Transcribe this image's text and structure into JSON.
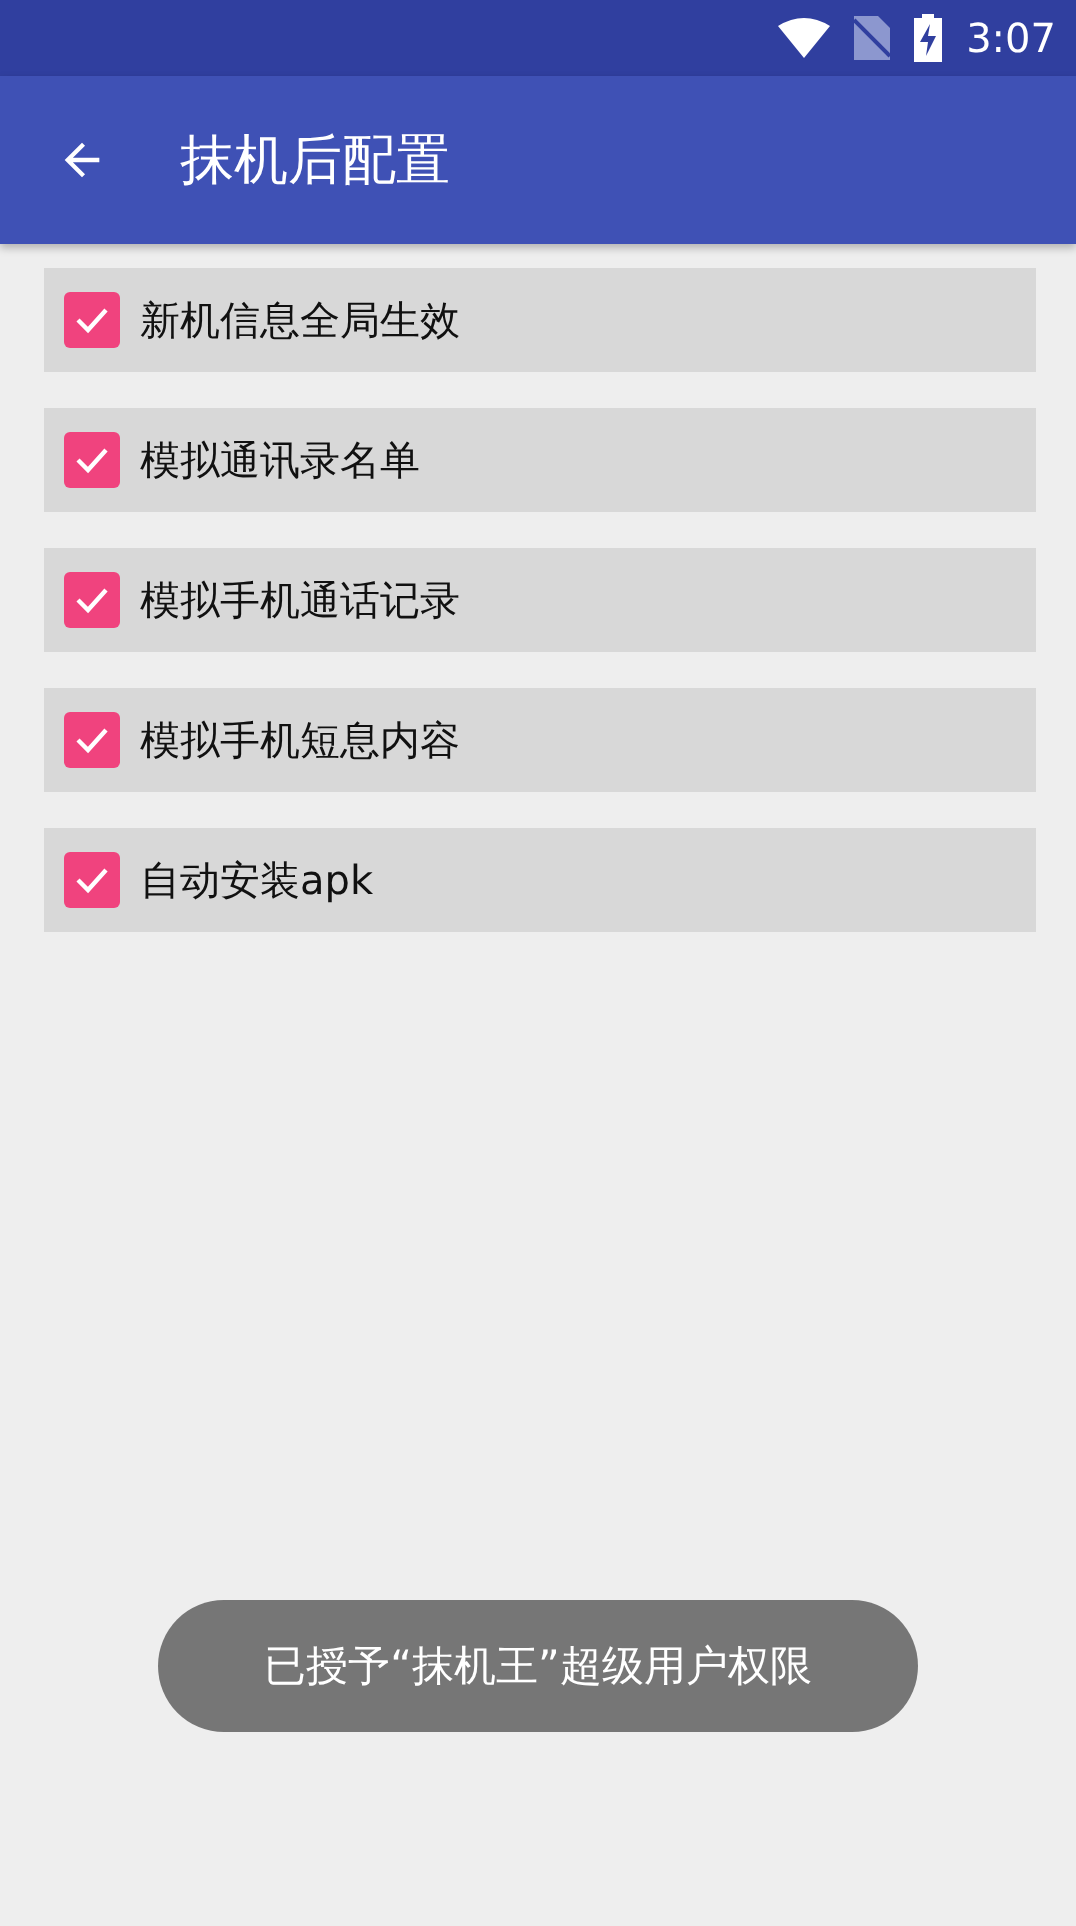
{
  "status_bar": {
    "time": "3:07"
  },
  "app_bar": {
    "title": "抹机后配置"
  },
  "options": [
    {
      "label": "新机信息全局生效",
      "checked": true
    },
    {
      "label": "模拟通讯录名单",
      "checked": true
    },
    {
      "label": "模拟手机通话记录",
      "checked": true
    },
    {
      "label": "模拟手机短息内容",
      "checked": true
    },
    {
      "label": "自动安装apk",
      "checked": true
    }
  ],
  "toast": {
    "text": "已授予“抹机王”超级用户权限"
  }
}
